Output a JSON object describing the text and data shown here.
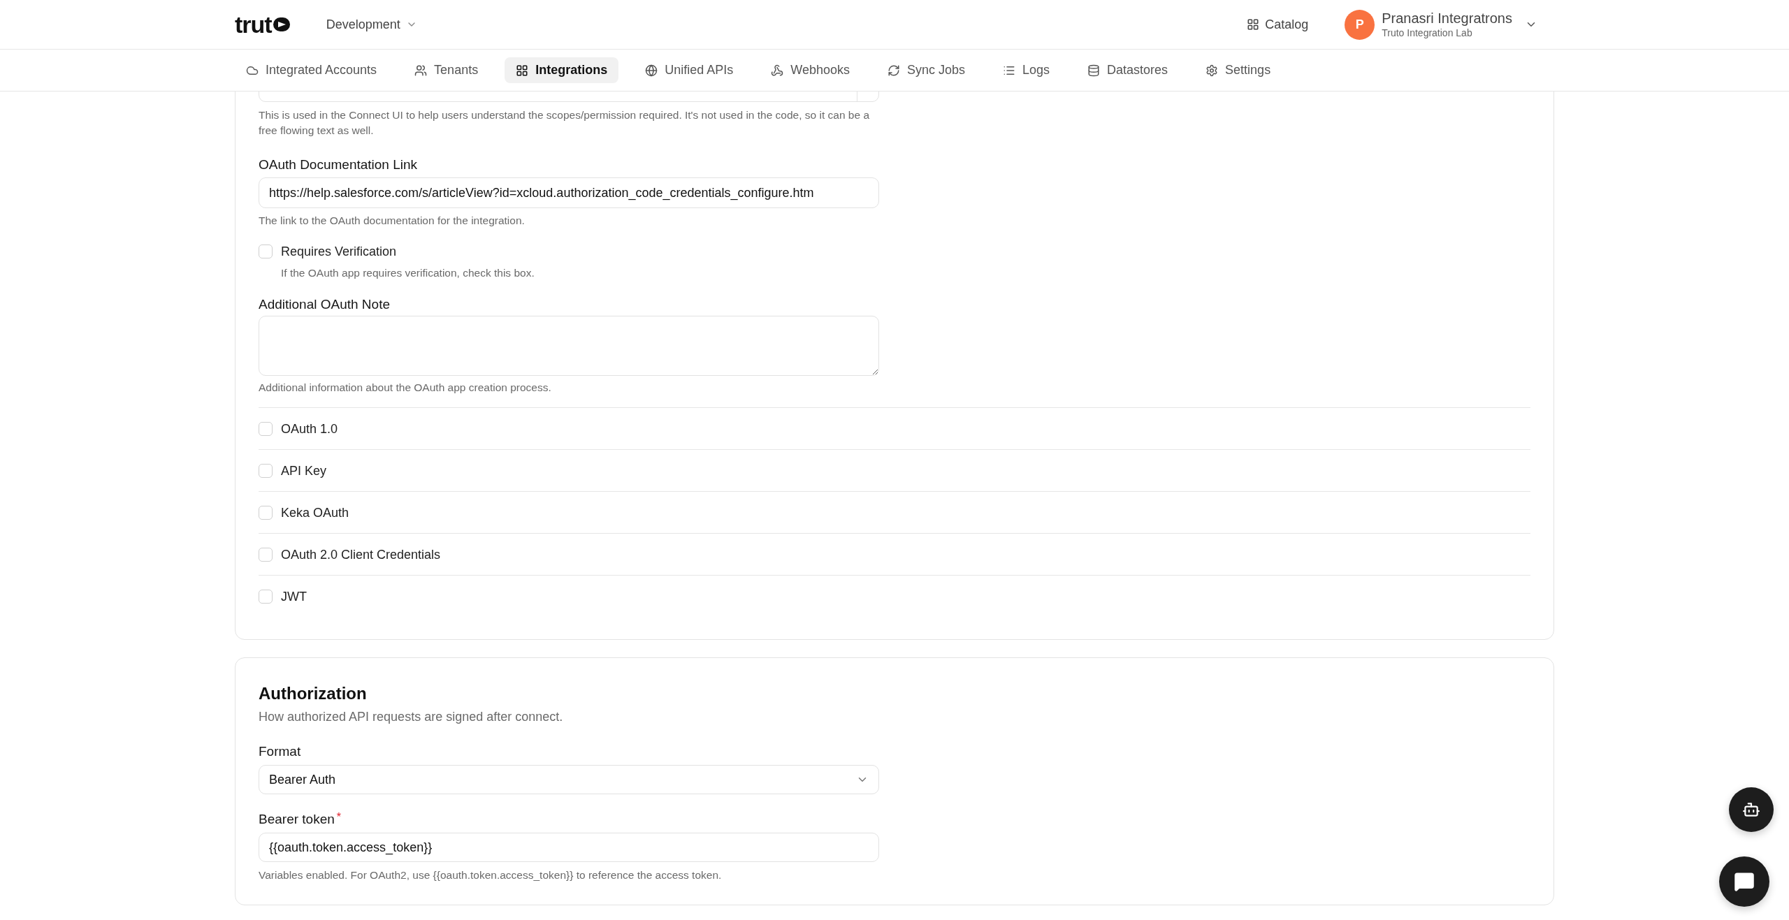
{
  "header": {
    "logo": "trut",
    "workspace": "Development",
    "catalog": "Catalog",
    "user": {
      "initial": "P",
      "name": "Pranasri Integratrons",
      "org": "Truto Integration Lab"
    }
  },
  "nav": [
    {
      "label": "Integrated Accounts",
      "selected": false
    },
    {
      "label": "Tenants",
      "selected": false
    },
    {
      "label": "Integrations",
      "selected": true
    },
    {
      "label": "Unified APIs",
      "selected": false
    },
    {
      "label": "Webhooks",
      "selected": false
    },
    {
      "label": "Sync Jobs",
      "selected": false
    },
    {
      "label": "Logs",
      "selected": false
    },
    {
      "label": "Datastores",
      "selected": false
    },
    {
      "label": "Settings",
      "selected": false
    }
  ],
  "oauth": {
    "scopes_help": "This is used in the Connect UI to help users understand the scopes/permission required. It's not used in the code, so it can be a free flowing text as well.",
    "doc_link": {
      "label": "OAuth Documentation Link",
      "value": "https://help.salesforce.com/s/articleView?id=xcloud.authorization_code_credentials_configure.htm",
      "help": "The link to the OAuth documentation for the integration."
    },
    "requires_verification": {
      "label": "Requires Verification",
      "help": "If the OAuth app requires verification, check this box.",
      "checked": false
    },
    "note": {
      "label": "Additional OAuth Note",
      "help": "Additional information about the OAuth app creation process."
    },
    "methods": [
      {
        "label": "OAuth 1.0",
        "checked": false
      },
      {
        "label": "API Key",
        "checked": false
      },
      {
        "label": "Keka OAuth",
        "checked": false
      },
      {
        "label": "OAuth 2.0 Client Credentials",
        "checked": false
      },
      {
        "label": "JWT",
        "checked": false
      }
    ]
  },
  "authorization": {
    "title": "Authorization",
    "description": "How authorized API requests are signed after connect.",
    "format": {
      "label": "Format",
      "value": "Bearer Auth"
    },
    "bearer": {
      "label": "Bearer token",
      "required_mark": "*",
      "value": "{{oauth.token.access_token}}",
      "help": "Variables enabled. For OAuth2, use {{oauth.token.access_token}} to reference the access token."
    }
  }
}
